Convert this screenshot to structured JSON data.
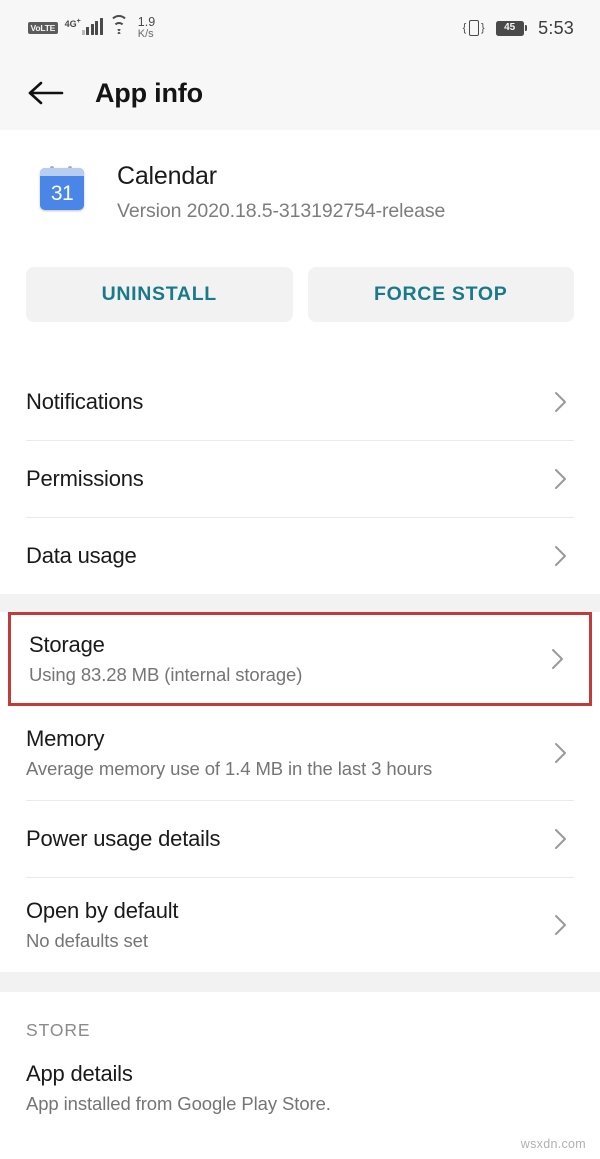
{
  "statusbar": {
    "volte": "VoLTE",
    "network": "4G",
    "network_sup": "+",
    "wifi_icon": "wifi-icon",
    "data_speed_value": "1.9",
    "data_speed_unit": "K/s",
    "vibrate_icon": "vibrate-icon",
    "battery_level": "45",
    "time": "5:53"
  },
  "appbar": {
    "back_icon": "back-arrow-icon",
    "title": "App info"
  },
  "app": {
    "icon_day": "31",
    "icon_name": "calendar-app-icon",
    "name": "Calendar",
    "version": "Version 2020.18.5-313192754-release"
  },
  "actions": {
    "uninstall_label": "UNINSTALL",
    "force_stop_label": "FORCE STOP"
  },
  "groups": [
    {
      "rows": [
        {
          "title": "Notifications",
          "sub": ""
        },
        {
          "title": "Permissions",
          "sub": ""
        },
        {
          "title": "Data usage",
          "sub": ""
        }
      ]
    },
    {
      "rows": [
        {
          "title": "Storage",
          "sub": "Using 83.28 MB (internal storage)",
          "highlighted": true
        },
        {
          "title": "Memory",
          "sub": "Average memory use of 1.4 MB in the last 3 hours"
        },
        {
          "title": "Power usage details",
          "sub": ""
        },
        {
          "title": "Open by default",
          "sub": "No defaults set"
        }
      ]
    }
  ],
  "store_section": {
    "label": "STORE",
    "rows": [
      {
        "title": "App details",
        "sub": "App installed from Google Play Store."
      }
    ]
  },
  "watermark": "wsxdn.com",
  "colors": {
    "accent_teal": "#1b7a8a",
    "highlight_red": "#c23b3b",
    "app_icon_blue": "#4a86e8",
    "header_bg": "#f7f7f7",
    "band_bg": "#f2f2f2"
  }
}
